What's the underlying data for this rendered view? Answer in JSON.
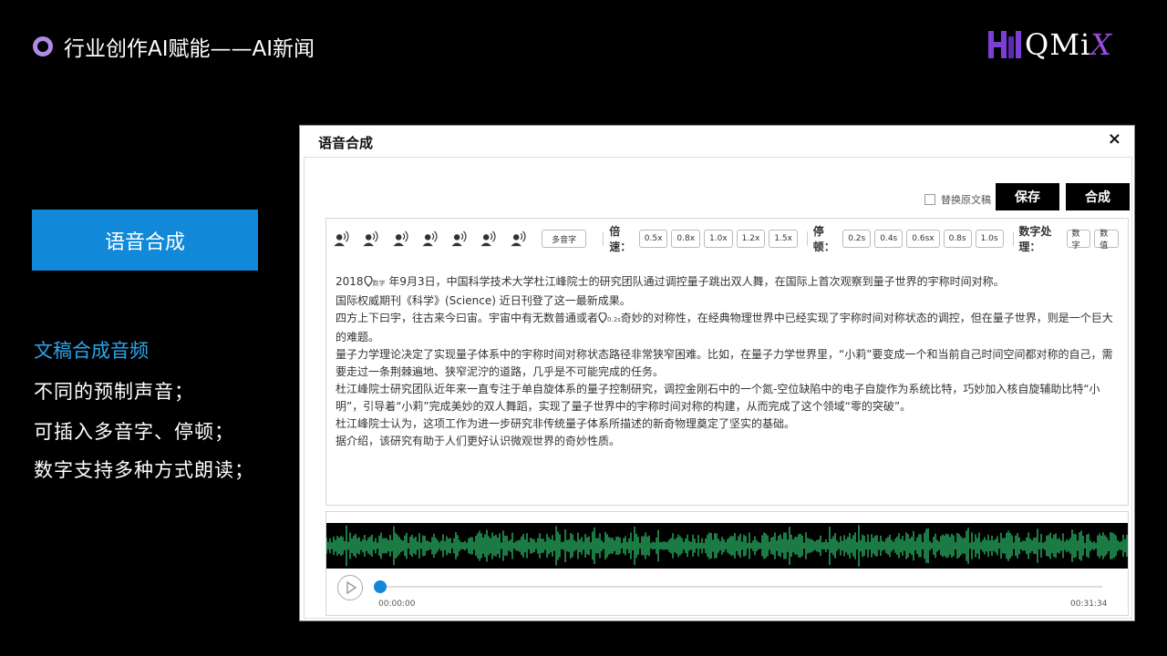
{
  "slide": {
    "title": "行业创作AI赋能——AI新闻",
    "logo_text": "QMi",
    "logo_x": "X",
    "feature_button": "语音合成",
    "desc_title": "文稿合成音频",
    "desc_lines": [
      "不同的预制声音；",
      "可插入多音字、停顿；",
      "数字支持多种方式朗读；"
    ]
  },
  "window": {
    "title": "语音合成",
    "close": "×",
    "replace_label": "替换原文稿",
    "save_button": "保存",
    "synthesize_button": "合成",
    "toolbar": {
      "polyphone": "多音字",
      "speed_label": "倍速：",
      "speeds": [
        "0.5x",
        "0.8x",
        "1.0x",
        "1.2x",
        "1.5x"
      ],
      "pause_label": "停顿：",
      "pauses": [
        "0.2s",
        "0.4s",
        "0.6sx",
        "0.8s",
        "1.0s"
      ],
      "number_label": "数字处理：",
      "number_modes": [
        "数字",
        "数值"
      ]
    },
    "text": {
      "p1_a": "2018",
      "p1_tag": "数字",
      "p1_b": " 年9月3日，中国科学技术大学杜江峰院士的研究团队通过调控量子跳出双人舞，在国际上首次观察到量子世界的宇称时间对称。",
      "p2": "国际权威期刊《科学》(Science) 近日刊登了这一最新成果。",
      "p3_a": "四方上下曰宇，往古来今曰宙。宇宙中有无数普通或者",
      "p3_tag": "0.2s",
      "p3_b": "奇妙的对称性，在经典物理世界中已经实现了宇称时间对称状态的调控，但在量子世界，则是一个巨大的难题。",
      "p4": "量子力学理论决定了实现量子体系中的宇称时间对称状态路径非常狭窄困难。比如，在量子力学世界里，“小莉”要变成一个和当前自己时间空间都对称的自己，需要走过一条荆棘遍地、狭窄泥泞的道路，几乎是不可能完成的任务。",
      "p5": "杜江峰院士研究团队近年来一直专注于单自旋体系的量子控制研究，调控金刚石中的一个氮-空位缺陷中的电子自旋作为系统比特，巧妙加入核自旋辅助比特“小明”，引导着“小莉”完成美妙的双人舞蹈，实现了量子世界中的宇称时间对称的构建，从而完成了这个领域“零的突破”。",
      "p6": "杜江峰院士认为，这项工作为进一步研究非传统量子体系所描述的新奇物理奠定了坚实的基础。",
      "p7": "据介绍，该研究有助于人们更好认识微观世界的奇妙性质。"
    },
    "player": {
      "current_time": "00:00:00",
      "total_time": "00:31:34",
      "progress": 0.0,
      "wave_color": "#2ecc71"
    }
  },
  "colors": {
    "accent": "#1189d8",
    "desc_title": "#2aa6ee",
    "bullet": "#b08be8",
    "logo_accent": "#9b4be0"
  }
}
